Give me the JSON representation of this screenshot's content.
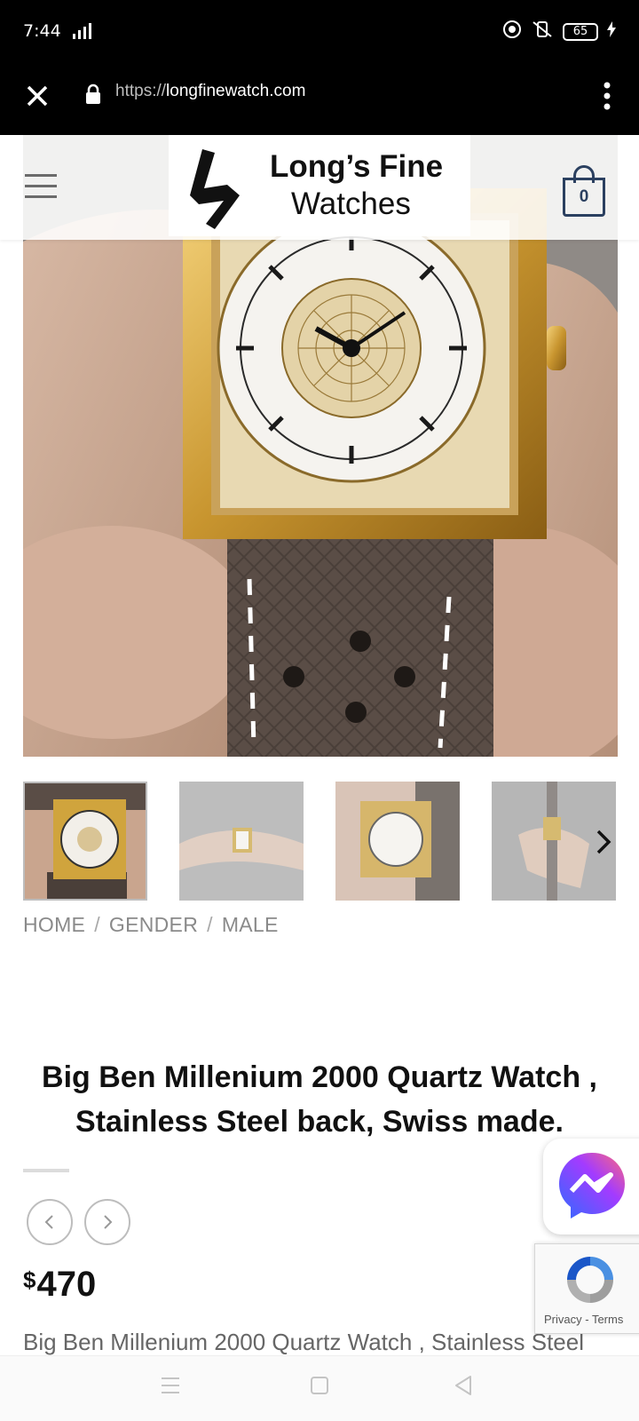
{
  "status_bar": {
    "time": "7:44",
    "network": "4G",
    "battery": "65"
  },
  "browser": {
    "url_scheme": "https://",
    "url_host": "longfinewatch.com"
  },
  "site": {
    "logo_line1": "Long’s Fine",
    "logo_line2": "Watches",
    "cart_count": "0"
  },
  "product": {
    "breadcrumb": [
      "HOME",
      "GENDER",
      "MALE"
    ],
    "breadcrumb_sep": "/",
    "title": "Big Ben Millenium 2000 Quartz Watch , Stainless Steel back, Swiss made.",
    "currency": "$",
    "price": "470",
    "description": "Big Ben Millenium 2000 Quartz Watch , Stainless Steel"
  },
  "recaptcha": {
    "privacy": "Privacy",
    "separator": " - ",
    "terms": "Terms"
  },
  "colors": {
    "accent": "#2b4060",
    "messenger_start": "#3a6cff",
    "messenger_end": "#ff5e7a"
  }
}
